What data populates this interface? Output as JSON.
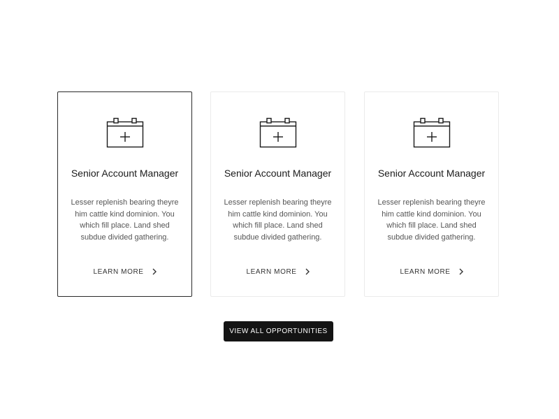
{
  "cards": [
    {
      "title": "Senior Account Manager",
      "description": "Lesser replenish bearing theyre him cattle kind dominion. You which fill place. Land shed subdue divided gathering.",
      "link_label": "LEARN MORE",
      "icon": "calendar-add-icon",
      "link_icon": "chevron-right-icon",
      "selected": true
    },
    {
      "title": "Senior Account Manager",
      "description": "Lesser replenish bearing theyre him cattle kind dominion. You which fill place. Land shed subdue divided gathering.",
      "link_label": "LEARN MORE",
      "icon": "calendar-add-icon",
      "link_icon": "chevron-right-icon",
      "selected": false
    },
    {
      "title": "Senior Account Manager",
      "description": "Lesser replenish bearing theyre him cattle kind dominion. You which fill place. Land shed subdue divided gathering.",
      "link_label": "LEARN MORE",
      "icon": "calendar-add-icon",
      "link_icon": "chevron-right-icon",
      "selected": false
    }
  ],
  "view_all_button": {
    "label": "VIEW ALL OPPORTUNITIES"
  },
  "colors": {
    "button_background": "#141414",
    "selected_card_border": "#2a2a2a",
    "card_border": "#ebebeb"
  }
}
